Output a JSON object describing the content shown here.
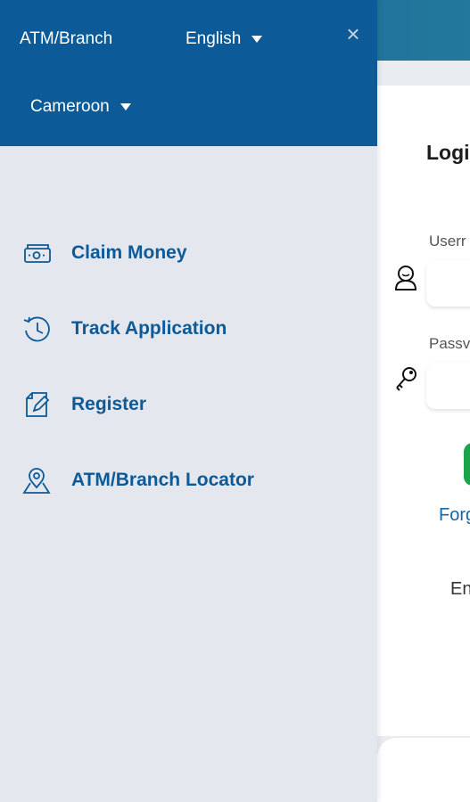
{
  "drawer": {
    "header": {
      "atm_branch": "ATM/Branch",
      "language": "English",
      "country": "Cameroon",
      "close_symbol": "×"
    },
    "items": [
      {
        "label": "Claim Money",
        "icon": "cash-icon"
      },
      {
        "label": "Track Application",
        "icon": "history-icon"
      },
      {
        "label": "Register",
        "icon": "edit-document-icon"
      },
      {
        "label": "ATM/Branch Locator",
        "icon": "map-pin-icon"
      }
    ]
  },
  "background": {
    "login_title": "Logi",
    "username_label": "Userr",
    "password_label": "Passv",
    "forgot_text": "Forg",
    "footer_text": "En"
  },
  "colors": {
    "drawer_header": "#0c5a97",
    "drawer_body": "#e4e7ee",
    "menu_text": "#0d5a98",
    "accent_green": "#1aa54a"
  }
}
